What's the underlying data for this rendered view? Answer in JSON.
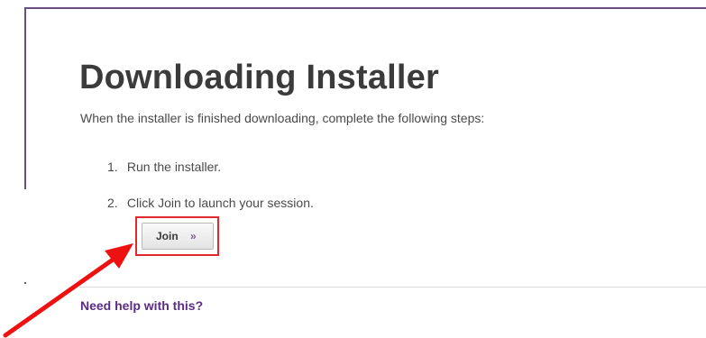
{
  "page": {
    "title": "Downloading Installer",
    "intro": "When the installer is finished downloading, complete the following steps:"
  },
  "steps": [
    {
      "number": "1.",
      "text": "Run the installer."
    },
    {
      "number": "2.",
      "text": "Click Join to launch your session."
    }
  ],
  "join_button": {
    "label": "Join",
    "icon": "double-chevron-right-icon",
    "chevron": "»"
  },
  "help_link": {
    "label": "Need help with this?"
  },
  "colors": {
    "accent_purple": "#5b2c83",
    "highlight_red": "#e0292e",
    "title_gray": "#3b3b3b"
  }
}
